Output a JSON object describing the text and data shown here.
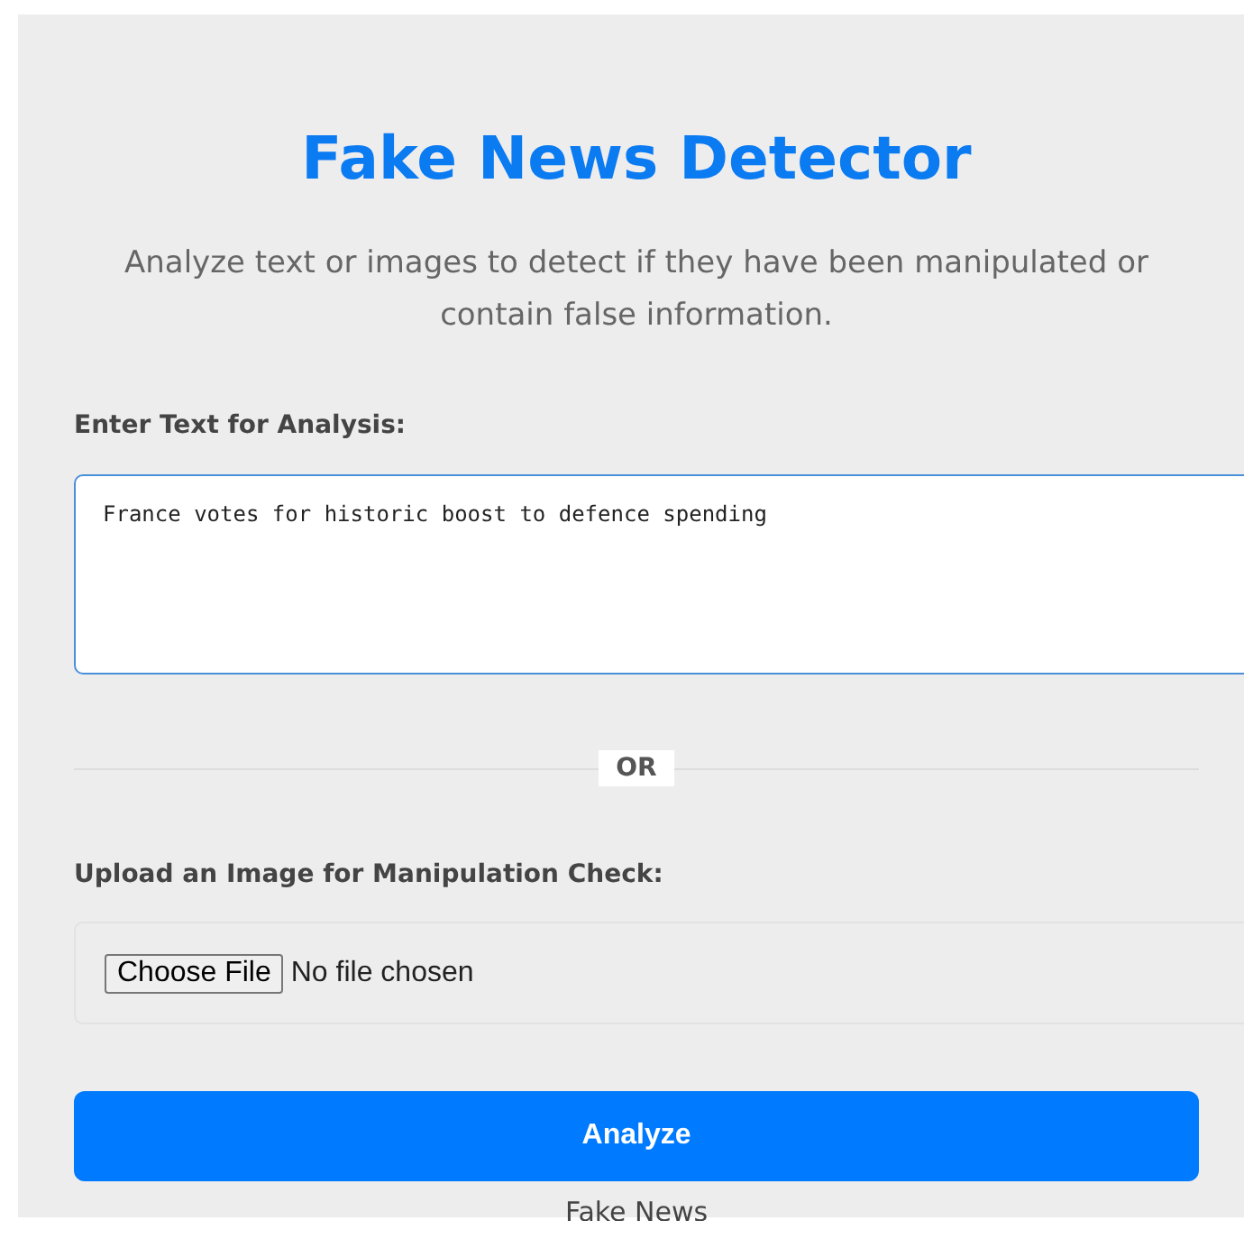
{
  "title": "Fake News Detector",
  "subtitle": "Analyze text or images to detect if they have been manipulated or contain false information.",
  "text_section": {
    "label": "Enter Text for Analysis:",
    "value": "France votes for historic boost to defence spending"
  },
  "divider": {
    "label": "OR"
  },
  "image_section": {
    "label": "Upload an Image for Manipulation Check:",
    "button": "Choose File",
    "status": "No file chosen"
  },
  "analyze_button": "Analyze",
  "result": "Fake News"
}
